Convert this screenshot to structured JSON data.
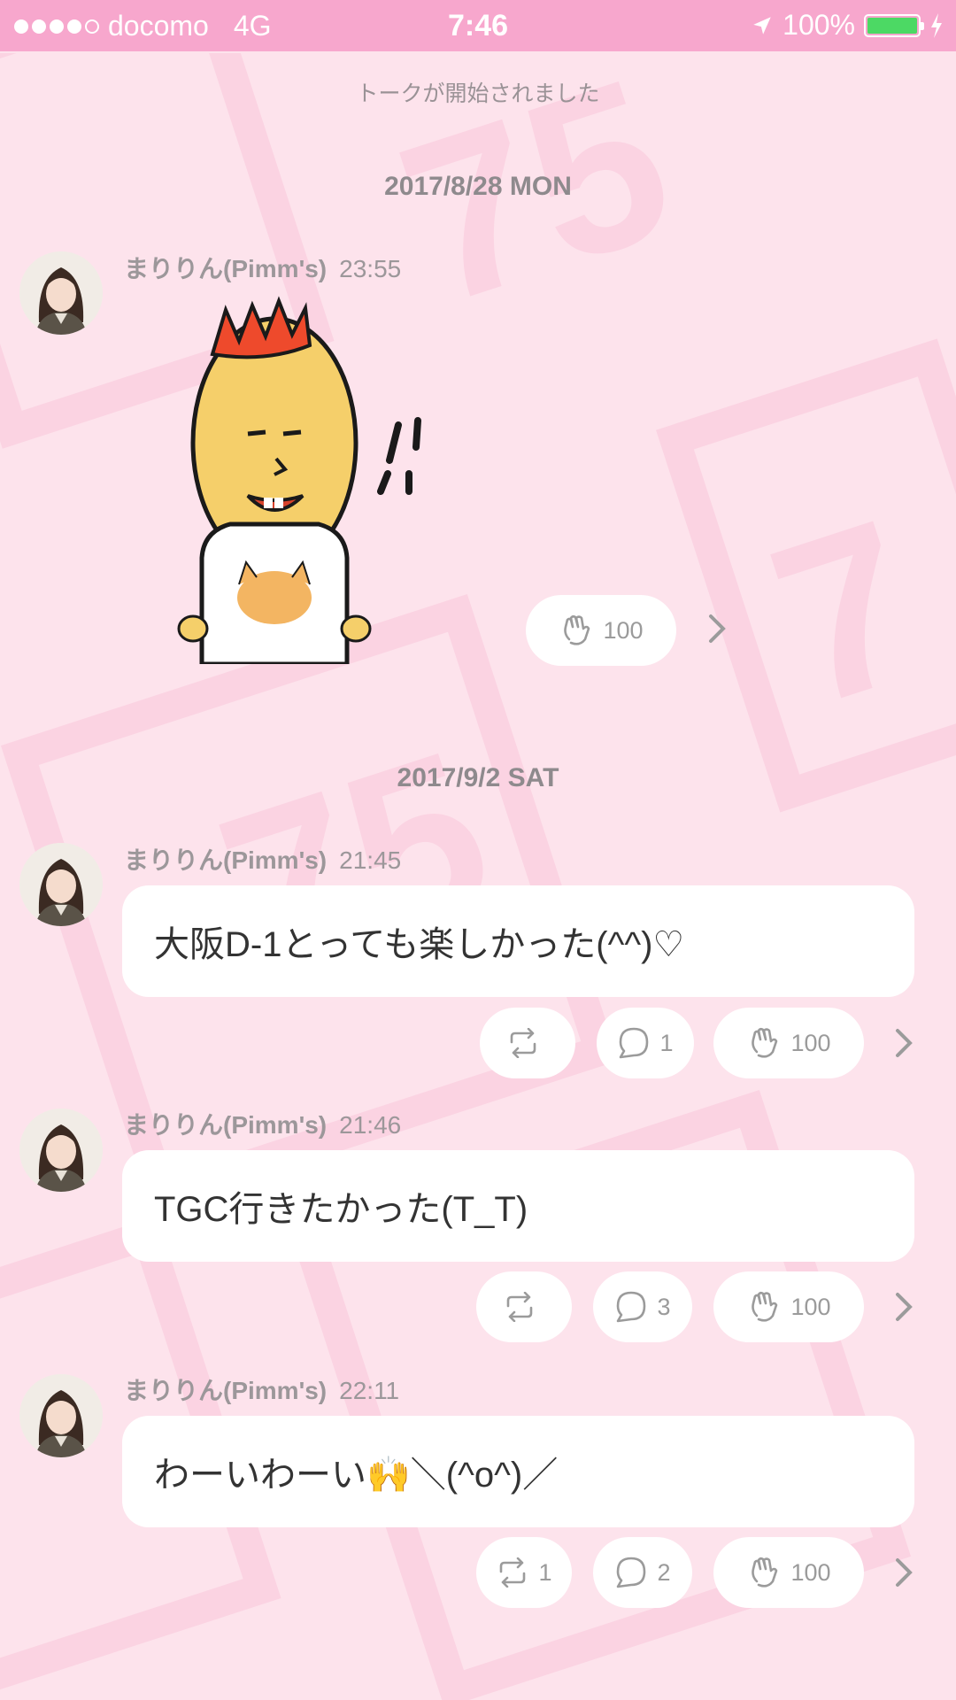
{
  "status_bar": {
    "carrier": "docomo",
    "network": "4G",
    "time": "7:46",
    "battery": "100%"
  },
  "system_message": "トークが開始されました",
  "groups": [
    {
      "date": "2017/8/28 MON"
    },
    {
      "date": "2017/9/2 SAT"
    }
  ],
  "messages": [
    {
      "sender": "まりりん(Pimm's)",
      "time": "23:55",
      "type": "sticker",
      "clap_count": "100"
    },
    {
      "sender": "まりりん(Pimm's)",
      "time": "21:45",
      "text": "大阪D-1とっても楽しかった(^^)♡",
      "repost_count": "",
      "comment_count": "1",
      "clap_count": "100"
    },
    {
      "sender": "まりりん(Pimm's)",
      "time": "21:46",
      "text": "TGC行きたかった(T_T)",
      "repost_count": "",
      "comment_count": "3",
      "clap_count": "100"
    },
    {
      "sender": "まりりん(Pimm's)",
      "time": "22:11",
      "text": "わーいわーい🙌＼(^o^)／",
      "repost_count": "1",
      "comment_count": "2",
      "clap_count": "100"
    }
  ],
  "colors": {
    "status_bar": "#f7a7cd",
    "background": "#fde3ec",
    "battery": "#4cd964"
  },
  "icons": [
    "location-arrow-icon",
    "battery-icon",
    "charging-bolt-icon",
    "repost-icon",
    "comment-icon",
    "clap-icon",
    "chevron-right-icon"
  ]
}
